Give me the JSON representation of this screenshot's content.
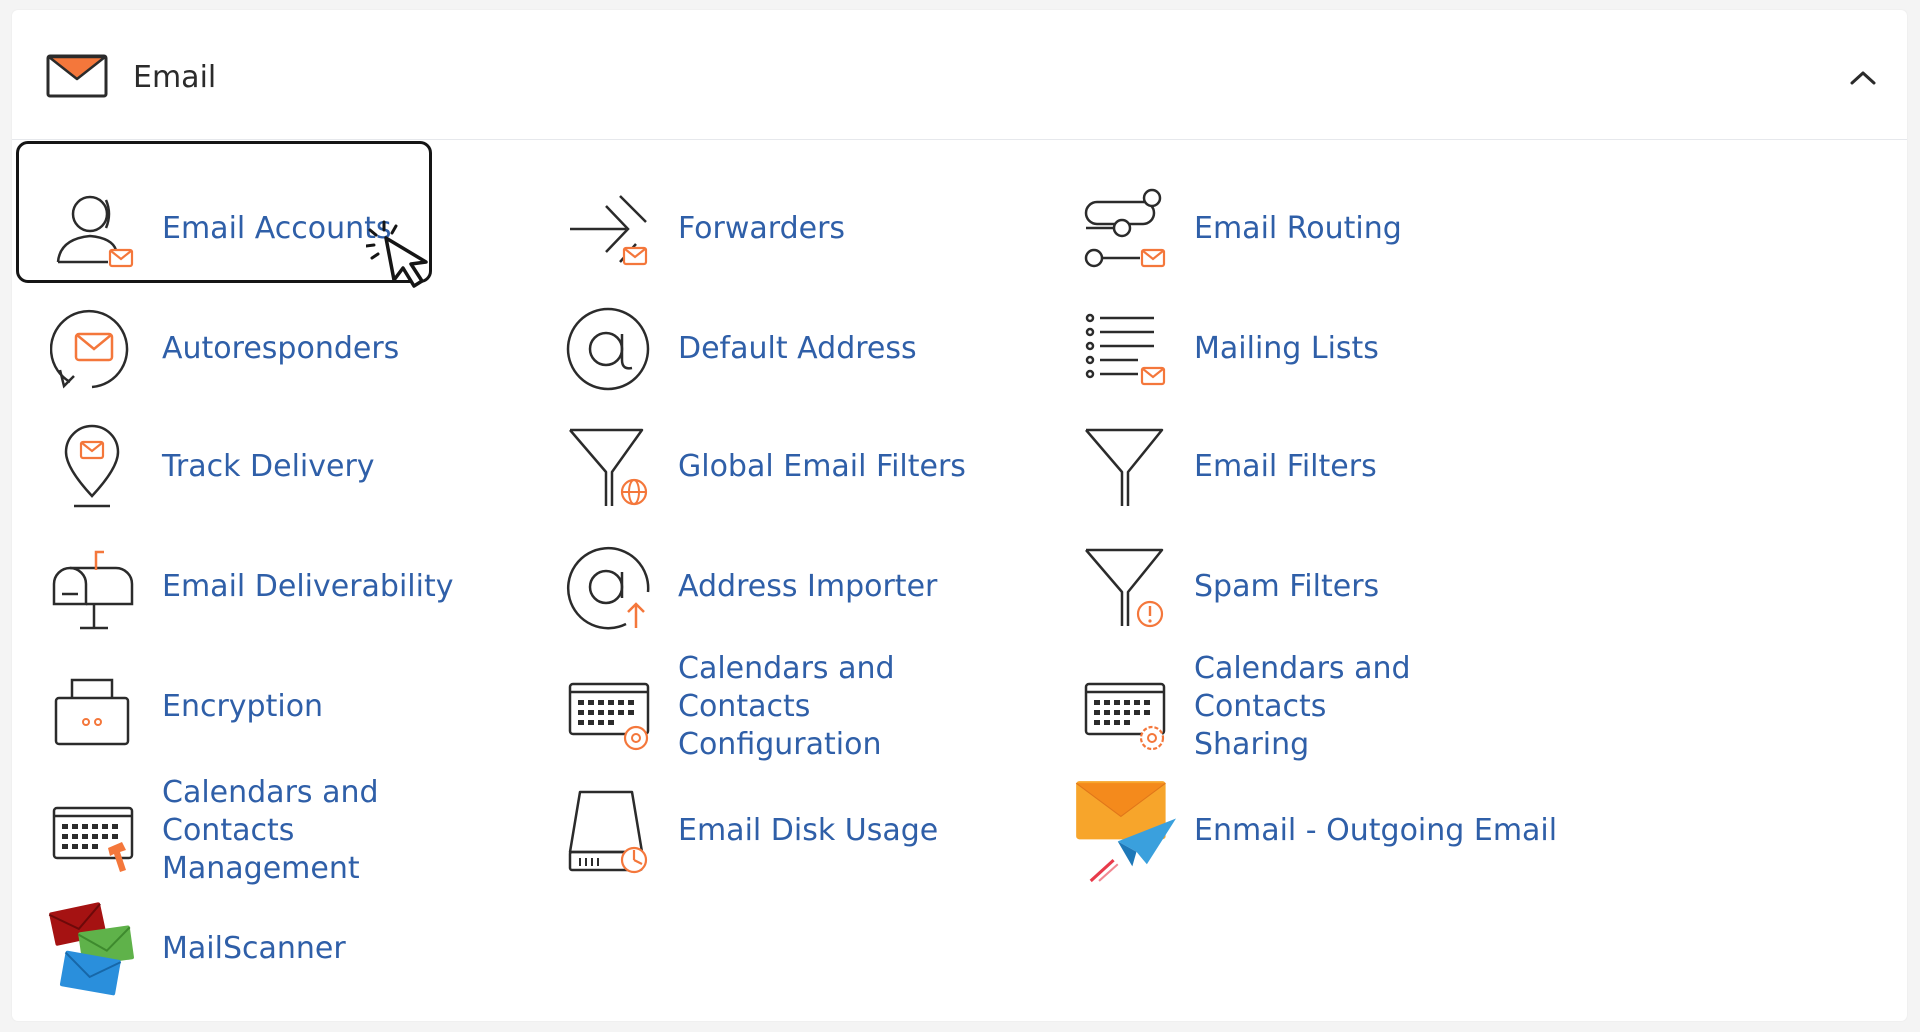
{
  "header": {
    "title": "Email"
  },
  "colors": {
    "link": "#2f5fa8",
    "accent": "#f4773b",
    "stroke": "#2b2b2b"
  },
  "items": [
    {
      "label": "Email Accounts",
      "icon": "user-mail-icon",
      "selected": true
    },
    {
      "label": "Forwarders",
      "icon": "forward-arrows-icon"
    },
    {
      "label": "Email Routing",
      "icon": "routing-icon"
    },
    {
      "label": "Autoresponders",
      "icon": "autoresponder-icon"
    },
    {
      "label": "Default Address",
      "icon": "at-sign-icon"
    },
    {
      "label": "Mailing Lists",
      "icon": "mailing-list-icon"
    },
    {
      "label": "Track Delivery",
      "icon": "location-pin-mail-icon"
    },
    {
      "label": "Global Email Filters",
      "icon": "filter-globe-icon"
    },
    {
      "label": "Email Filters",
      "icon": "filter-icon"
    },
    {
      "label": "Email Deliverability",
      "icon": "mailbox-icon"
    },
    {
      "label": "Address Importer",
      "icon": "at-import-icon"
    },
    {
      "label": "Spam Filters",
      "icon": "filter-warning-icon"
    },
    {
      "label": "Encryption",
      "icon": "lock-box-icon"
    },
    {
      "label": "Calendars and Contacts\nConfiguration",
      "icon": "calendar-at-icon"
    },
    {
      "label": "Calendars and Contacts\nSharing",
      "icon": "calendar-gear-icon"
    },
    {
      "label": "Calendars and Contacts\nManagement",
      "icon": "calendar-hammer-icon"
    },
    {
      "label": "Email Disk Usage",
      "icon": "disk-usage-icon"
    },
    {
      "label": "Enmail - Outgoing Email",
      "icon": "enmail-paper-plane-icon"
    },
    {
      "label": "MailScanner",
      "icon": "mailscanner-envelopes-icon"
    }
  ]
}
